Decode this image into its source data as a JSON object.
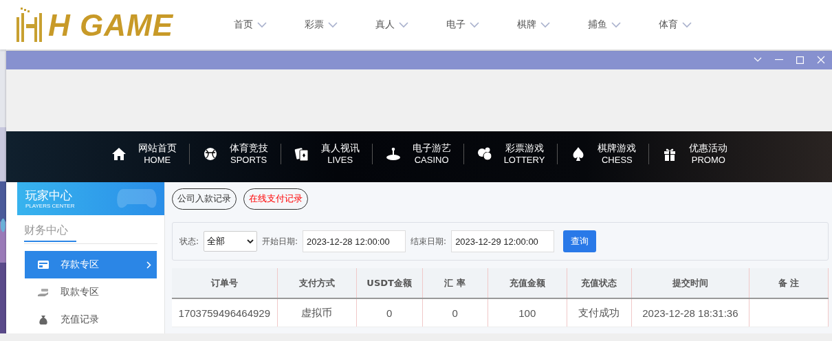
{
  "logo": {
    "text": "H GAME"
  },
  "top_nav": [
    {
      "label": "首页"
    },
    {
      "label": "彩票"
    },
    {
      "label": "真人"
    },
    {
      "label": "电子"
    },
    {
      "label": "棋牌"
    },
    {
      "label": "捕鱼"
    },
    {
      "label": "体育"
    }
  ],
  "banner_nav": [
    {
      "kind": "home",
      "title": "网站首页",
      "subtitle": "HOME"
    },
    {
      "kind": "sports",
      "title": "体育竞技",
      "subtitle": "SPORTS"
    },
    {
      "kind": "cards",
      "title": "真人视讯",
      "subtitle": "LIVES"
    },
    {
      "kind": "casino",
      "title": "电子游艺",
      "subtitle": "CASINO"
    },
    {
      "kind": "lottery",
      "title": "彩票游戏",
      "subtitle": "LOTTERY"
    },
    {
      "kind": "chess",
      "title": "棋牌游戏",
      "subtitle": "CHESS"
    },
    {
      "kind": "gift",
      "title": "优惠活动",
      "subtitle": "PROMO"
    }
  ],
  "sidebar": {
    "title": "玩家中心",
    "subtitle": "PLAYERS CENTER",
    "section": "财务中心",
    "items": [
      {
        "kind": "card",
        "label": "存款专区",
        "selected": true
      },
      {
        "kind": "hand",
        "label": "取款专区",
        "selected": false
      },
      {
        "kind": "bag",
        "label": "充值记录",
        "selected": false
      }
    ]
  },
  "record_tabs": [
    {
      "label": "公司入款记录",
      "selected": false
    },
    {
      "label": "在线支付记录",
      "selected": true
    }
  ],
  "filter": {
    "status_label": "状态:",
    "status_value": "全部",
    "start_label": "开始日期:",
    "start_value": "2023-12-28 12:00:00",
    "end_label": "结束日期:",
    "end_value": "2023-12-29 12:00:00",
    "query_button": "查询"
  },
  "table": {
    "columns": [
      "订单号",
      "支付方式",
      "USDT金额",
      "汇 率",
      "充值金额",
      "充值状态",
      "提交时间",
      "备 注"
    ],
    "rows": [
      [
        "1703759496464929",
        "虚拟币",
        "0",
        "0",
        "100",
        "支付成功",
        "2023-12-28 18:31:36",
        ""
      ]
    ]
  }
}
